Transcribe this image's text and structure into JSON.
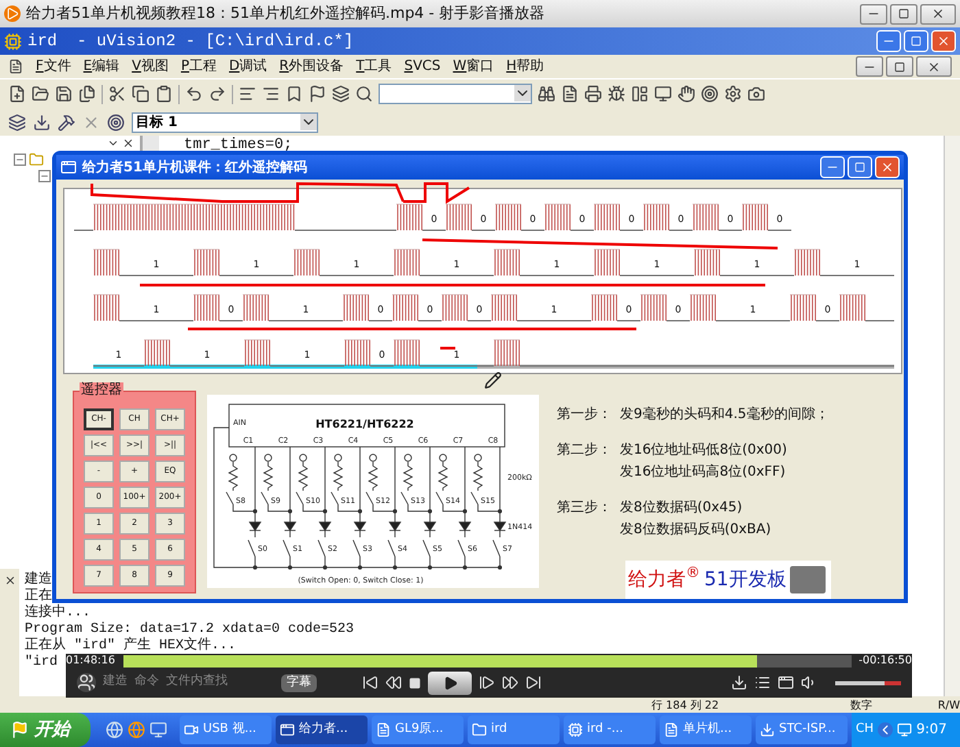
{
  "player": {
    "title": "给力者51单片机视频教程18：51单片机红外遥控解码.mp4 - 射手影音播放器"
  },
  "ide": {
    "title": "ird  - uVision2 - [C:\\ird\\ird.c*]",
    "menu": [
      {
        "key": "F",
        "label": "文件"
      },
      {
        "key": "E",
        "label": "编辑"
      },
      {
        "key": "V",
        "label": "视图"
      },
      {
        "key": "P",
        "label": "工程"
      },
      {
        "key": "D",
        "label": "调试"
      },
      {
        "key": "R",
        "label": "外围设备"
      },
      {
        "key": "T",
        "label": "工具"
      },
      {
        "key": "S",
        "label": "VCS"
      },
      {
        "key": "W",
        "label": "窗口"
      },
      {
        "key": "H",
        "label": "帮助"
      }
    ],
    "target": "目标 1",
    "code_line": "tmr_times=0;"
  },
  "dialog": {
    "title": "给力者51单片机课件：红外遥控解码",
    "waveform": [
      {
        "items": [
          {
            "kind": "lead_line"
          },
          {
            "kind": "header_burst"
          },
          {
            "kind": "header_gap"
          },
          {
            "kind": "burst"
          },
          {
            "kind": "short_gap",
            "label": "0"
          },
          {
            "kind": "burst"
          },
          {
            "kind": "short_gap",
            "label": "0"
          },
          {
            "kind": "burst"
          },
          {
            "kind": "short_gap",
            "label": "0"
          },
          {
            "kind": "burst"
          },
          {
            "kind": "short_gap",
            "label": "0"
          },
          {
            "kind": "burst"
          },
          {
            "kind": "short_gap",
            "label": "0"
          },
          {
            "kind": "burst"
          },
          {
            "kind": "short_gap",
            "label": "0"
          },
          {
            "kind": "burst"
          },
          {
            "kind": "short_gap",
            "label": "0"
          },
          {
            "kind": "burst"
          },
          {
            "kind": "short_gap",
            "label": "0"
          }
        ]
      },
      {
        "items": [
          {
            "kind": "burst"
          },
          {
            "kind": "long_gap",
            "label": "1"
          },
          {
            "kind": "burst"
          },
          {
            "kind": "long_gap",
            "label": "1"
          },
          {
            "kind": "burst"
          },
          {
            "kind": "long_gap",
            "label": "1"
          },
          {
            "kind": "burst"
          },
          {
            "kind": "long_gap",
            "label": "1"
          },
          {
            "kind": "burst"
          },
          {
            "kind": "long_gap",
            "label": "1"
          },
          {
            "kind": "burst"
          },
          {
            "kind": "long_gap",
            "label": "1"
          },
          {
            "kind": "burst"
          },
          {
            "kind": "long_gap",
            "label": "1"
          },
          {
            "kind": "burst"
          },
          {
            "kind": "long_gap",
            "label": "1"
          }
        ]
      },
      {
        "items": [
          {
            "kind": "burst"
          },
          {
            "kind": "long_gap",
            "label": "1"
          },
          {
            "kind": "burst"
          },
          {
            "kind": "short_gap",
            "label": "0"
          },
          {
            "kind": "burst"
          },
          {
            "kind": "long_gap",
            "label": "1"
          },
          {
            "kind": "burst"
          },
          {
            "kind": "short_gap",
            "label": "0"
          },
          {
            "kind": "burst"
          },
          {
            "kind": "short_gap",
            "label": "0"
          },
          {
            "kind": "burst"
          },
          {
            "kind": "short_gap",
            "label": "0"
          },
          {
            "kind": "burst"
          },
          {
            "kind": "long_gap",
            "label": "1"
          },
          {
            "kind": "burst"
          },
          {
            "kind": "short_gap",
            "label": "0"
          },
          {
            "kind": "burst"
          },
          {
            "kind": "short_gap",
            "label": "0"
          },
          {
            "kind": "burst"
          },
          {
            "kind": "long_gap",
            "label": "1"
          },
          {
            "kind": "burst"
          },
          {
            "kind": "short_gap",
            "label": "0"
          },
          {
            "kind": "burst"
          },
          {
            "kind": "tail_line"
          }
        ]
      },
      {
        "level": 0.48,
        "items": [
          {
            "kind": "partial_gap",
            "label": "1"
          },
          {
            "kind": "burst"
          },
          {
            "kind": "long_gap",
            "label": "1"
          },
          {
            "kind": "burst"
          },
          {
            "kind": "long_gap",
            "label": "1"
          },
          {
            "kind": "burst"
          },
          {
            "kind": "short_gap",
            "label": "0"
          },
          {
            "kind": "burst"
          },
          {
            "kind": "long_gap",
            "label": "1"
          },
          {
            "kind": "burst"
          },
          {
            "kind": "tail_line"
          }
        ]
      }
    ],
    "remote": {
      "title": "遥控器",
      "buttons": [
        {
          "label": "CH-",
          "selected": true
        },
        {
          "label": "CH",
          "selected": false
        },
        {
          "label": "CH+",
          "selected": false
        },
        {
          "label": "|<<",
          "selected": false
        },
        {
          "label": ">>|",
          "selected": false
        },
        {
          "label": ">||",
          "selected": false
        },
        {
          "label": "-",
          "selected": false
        },
        {
          "label": "+",
          "selected": false
        },
        {
          "label": "EQ",
          "selected": false
        },
        {
          "label": "0",
          "selected": false
        },
        {
          "label": "100+",
          "selected": false
        },
        {
          "label": "200+",
          "selected": false
        },
        {
          "label": "1",
          "selected": false
        },
        {
          "label": "2",
          "selected": false
        },
        {
          "label": "3",
          "selected": false
        },
        {
          "label": "4",
          "selected": false
        },
        {
          "label": "5",
          "selected": false
        },
        {
          "label": "6",
          "selected": false
        },
        {
          "label": "7",
          "selected": false
        },
        {
          "label": "8",
          "selected": false
        },
        {
          "label": "9",
          "selected": false
        }
      ]
    },
    "circuit": {
      "chip": "HT6221/HT6222",
      "input": "AIN",
      "columns": [
        "C1",
        "C2",
        "C3",
        "C4",
        "C5",
        "C6",
        "C7",
        "C8"
      ],
      "upper_switches": [
        "S8",
        "S9",
        "S10",
        "S11",
        "S12",
        "S13",
        "S14",
        "S15"
      ],
      "lower_switches": [
        "S0",
        "S1",
        "S2",
        "S3",
        "S4",
        "S5",
        "S6",
        "S7"
      ],
      "resistor": "200kΩ",
      "diode": "1N414",
      "caption": "(Switch Open: 0,  Switch Close: 1)"
    },
    "steps": [
      {
        "label": "第一步：",
        "lines": [
          "发9毫秒的头码和4.5毫秒的间隙；"
        ]
      },
      {
        "label": "第二步：",
        "lines": [
          "发16位地址码低8位(0x00)",
          "发16位地址码高8位(0xFF)"
        ]
      },
      {
        "label": "第三步：",
        "lines": [
          "发8位数据码(0x45)",
          "发8位数据码反码(0xBA)"
        ]
      }
    ],
    "logo": {
      "brand": "给力者$^{®}$",
      "product": "51开发板"
    }
  },
  "output": {
    "lines": [
      "建造",
      "正在",
      "连接中...",
      "Program Size: data=17.2 xdata=0 code=523",
      "正在从 \"ird\" 产生 HEX文件...",
      "\"ird"
    ]
  },
  "playback": {
    "elapsed": "01:48:16",
    "remaining": "-00:16:50",
    "level": 0.87,
    "output_tabs": [
      "建造",
      "命令",
      "文件内查找"
    ],
    "subtitle_button": "字幕",
    "volume": {
      "level": 0.75
    }
  },
  "status_bar": {
    "position": "行 184 列 22",
    "mode": "数字",
    "access": "R/W"
  },
  "taskbar": {
    "start": "开始",
    "tasks": [
      {
        "label": "USB 视...",
        "selected": false
      },
      {
        "label": "给力者...",
        "selected": true
      },
      {
        "label": "GL9原...",
        "selected": false
      },
      {
        "label": "ird",
        "selected": false
      },
      {
        "label": "ird  -...",
        "selected": false
      },
      {
        "label": "单片机...",
        "selected": false
      },
      {
        "label": "STC-ISP...",
        "selected": false
      }
    ],
    "language": "CH",
    "clock": "9:07"
  }
}
